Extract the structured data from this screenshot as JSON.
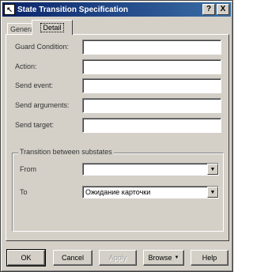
{
  "window": {
    "title": "State Transition Specification",
    "icon": "pointer-icon",
    "help_button": "?",
    "close_button": "X"
  },
  "tabs": [
    {
      "label": "General"
    },
    {
      "label": "Detail"
    }
  ],
  "fields": [
    {
      "label": "Guard Condition:",
      "value": ""
    },
    {
      "label": "Action:",
      "value": ""
    },
    {
      "label": "Send event:",
      "value": ""
    },
    {
      "label": "Send arguments:",
      "value": ""
    },
    {
      "label": "Send target:",
      "value": ""
    }
  ],
  "substates": {
    "legend": "Transition between substates",
    "from_label": "From",
    "from_value": "",
    "to_label": "To",
    "to_value": "Ожидание карточки"
  },
  "buttons": {
    "ok": "OK",
    "cancel": "Cancel",
    "apply": "Apply",
    "browse": "Browse",
    "help": "Help"
  }
}
